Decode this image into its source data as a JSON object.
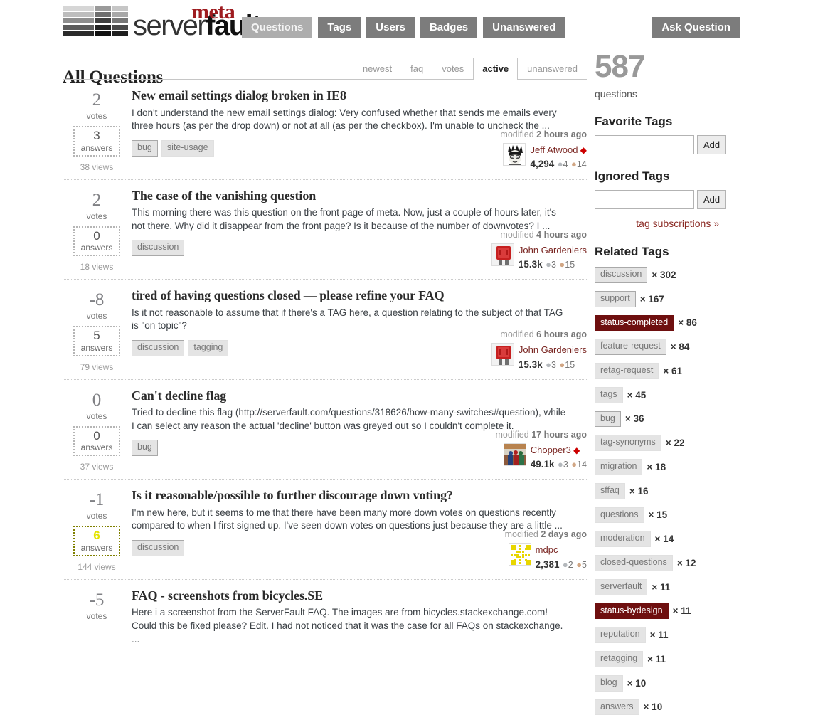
{
  "header": {
    "logo": {
      "meta_word": "meta",
      "site_light": "server",
      "site_bold": "fault"
    },
    "nav": [
      {
        "label": "Questions",
        "active": true
      },
      {
        "label": "Tags",
        "active": false
      },
      {
        "label": "Users",
        "active": false
      },
      {
        "label": "Badges",
        "active": false
      },
      {
        "label": "Unanswered",
        "active": false
      }
    ],
    "ask_label": "Ask Question"
  },
  "main": {
    "page_title": "All Questions",
    "tabs": [
      {
        "label": "newest",
        "selected": false
      },
      {
        "label": "faq",
        "selected": false
      },
      {
        "label": "votes",
        "selected": false
      },
      {
        "label": "active",
        "selected": true
      },
      {
        "label": "unanswered",
        "selected": false
      }
    ],
    "questions": [
      {
        "votes": "2",
        "votes_label": "votes",
        "answers": "3",
        "answers_label": "answers",
        "accepted": false,
        "views": "38 views",
        "title": "New email settings dialog broken in IE8",
        "excerpt": "I don't understand the new email settings dialog: Very confused whether that sends me emails every three hours (as per the drop down) or not at all (as per the checkbox). I'm unable to uncheck the ...",
        "tags": [
          {
            "label": "bug",
            "strong": true
          },
          {
            "label": "site-usage",
            "strong": false
          }
        ],
        "modified_prefix": "modified ",
        "modified_value": "2 hours ago",
        "user": {
          "name": "Jeff Atwood",
          "moderator": true,
          "rep": "4,294",
          "silver": "4",
          "bronze": "14",
          "avatar": "jeff-atwood-avatar"
        }
      },
      {
        "votes": "2",
        "votes_label": "votes",
        "answers": "0",
        "answers_label": "answers",
        "accepted": false,
        "views": "18 views",
        "title": "The case of the vanishing question",
        "excerpt": "This morning there was this question on the front page of meta. Now, just a couple of hours later, it's not there. Why did it disappear from the front page? Is it because of the number of downvotes? I ...",
        "tags": [
          {
            "label": "discussion",
            "strong": true
          }
        ],
        "modified_prefix": "modified ",
        "modified_value": "4 hours ago",
        "user": {
          "name": "John Gardeniers",
          "moderator": false,
          "rep": "15.3k",
          "silver": "3",
          "bronze": "15",
          "avatar": "red-fuse-avatar"
        }
      },
      {
        "votes": "-8",
        "votes_label": "votes",
        "answers": "5",
        "answers_label": "answers",
        "accepted": false,
        "views": "79 views",
        "title": "tired of having questions closed — please refine your FAQ",
        "excerpt": "Is it not reasonable to assume that if there's a TAG here, a question relating to the subject of that TAG is \"on topic\"?",
        "tags": [
          {
            "label": "discussion",
            "strong": true
          },
          {
            "label": "tagging",
            "strong": false
          }
        ],
        "modified_prefix": "modified ",
        "modified_value": "6 hours ago",
        "user": {
          "name": "John Gardeniers",
          "moderator": false,
          "rep": "15.3k",
          "silver": "3",
          "bronze": "15",
          "avatar": "red-fuse-avatar"
        }
      },
      {
        "votes": "0",
        "votes_label": "votes",
        "answers": "0",
        "answers_label": "answers",
        "accepted": false,
        "views": "37 views",
        "title": "Can't decline flag",
        "excerpt": "Tried to decline this flag (http://serverfault.com/questions/318626/how-many-switches#question), while I can select any reason the actual 'decline' button was greyed out so I couldn't complete it.",
        "tags": [
          {
            "label": "bug",
            "strong": true
          }
        ],
        "modified_prefix": "modified ",
        "modified_value": "17 hours ago",
        "user": {
          "name": "Chopper3",
          "moderator": true,
          "rep": "49.1k",
          "silver": "3",
          "bronze": "14",
          "avatar": "photo-avatar"
        }
      },
      {
        "votes": "-1",
        "votes_label": "votes",
        "answers": "6",
        "answers_label": "answers",
        "accepted": true,
        "views": "144 views",
        "title": "Is it reasonable/possible to further discourage down voting?",
        "excerpt": "I'm new here, but it seems to me that there have been many more down votes on questions recently compared to when I first signed up. I've seen down votes on questions just because they are a little ...",
        "tags": [
          {
            "label": "discussion",
            "strong": true
          }
        ],
        "modified_prefix": "modified ",
        "modified_value": "2 days ago",
        "user": {
          "name": "mdpc",
          "moderator": false,
          "rep": "2,381",
          "silver": "2",
          "bronze": "5",
          "avatar": "yellow-identicon-avatar"
        }
      },
      {
        "votes": "-5",
        "votes_label": "votes",
        "answers": "",
        "answers_label": "",
        "accepted": false,
        "views": "",
        "title": "FAQ - screenshots from bicycles.SE",
        "excerpt": "Here i a screenshot from the ServerFault FAQ. The images are from bicycles.stackexchange.com! Could this be fixed please? Edit. I had not noticed that it was the case for all FAQs on stackexchange. ...",
        "tags": [],
        "modified_prefix": "",
        "modified_value": "",
        "user": null
      }
    ]
  },
  "sidebar": {
    "question_count": "587",
    "question_count_label": "questions",
    "favorite_tags_heading": "Favorite Tags",
    "favorite_tags_value": "",
    "favorite_tags_add": "Add",
    "ignored_tags_heading": "Ignored Tags",
    "ignored_tags_value": "",
    "ignored_tags_add": "Add",
    "tag_subscriptions_link": "tag subscriptions »",
    "related_tags_heading": "Related Tags",
    "related_tags": [
      {
        "label": "discussion",
        "count": "× 302",
        "style": "strong"
      },
      {
        "label": "support",
        "count": "× 167",
        "style": "strong"
      },
      {
        "label": "status-completed",
        "count": "× 86",
        "style": "status"
      },
      {
        "label": "feature-request",
        "count": "× 84",
        "style": "strong"
      },
      {
        "label": "retag-request",
        "count": "× 61",
        "style": "normal"
      },
      {
        "label": "tags",
        "count": "× 45",
        "style": "normal"
      },
      {
        "label": "bug",
        "count": "× 36",
        "style": "strong"
      },
      {
        "label": "tag-synonyms",
        "count": "× 22",
        "style": "normal"
      },
      {
        "label": "migration",
        "count": "× 18",
        "style": "normal"
      },
      {
        "label": "sffaq",
        "count": "× 16",
        "style": "normal"
      },
      {
        "label": "questions",
        "count": "× 15",
        "style": "normal"
      },
      {
        "label": "moderation",
        "count": "× 14",
        "style": "normal"
      },
      {
        "label": "closed-questions",
        "count": "× 12",
        "style": "normal"
      },
      {
        "label": "serverfault",
        "count": "× 11",
        "style": "normal"
      },
      {
        "label": "status-bydesign",
        "count": "× 11",
        "style": "status"
      },
      {
        "label": "reputation",
        "count": "× 11",
        "style": "normal"
      },
      {
        "label": "retagging",
        "count": "× 11",
        "style": "normal"
      },
      {
        "label": "blog",
        "count": "× 10",
        "style": "normal"
      },
      {
        "label": "answers",
        "count": "× 10",
        "style": "normal"
      }
    ]
  },
  "colors": {
    "nav_button": "#7c7c7c",
    "nav_button_active": "#adadad",
    "link_red": "#8b2a24",
    "status_tag": "#6e0f0f",
    "accepted_answer": "#808000",
    "moderator_diamond": "#cc0000"
  }
}
